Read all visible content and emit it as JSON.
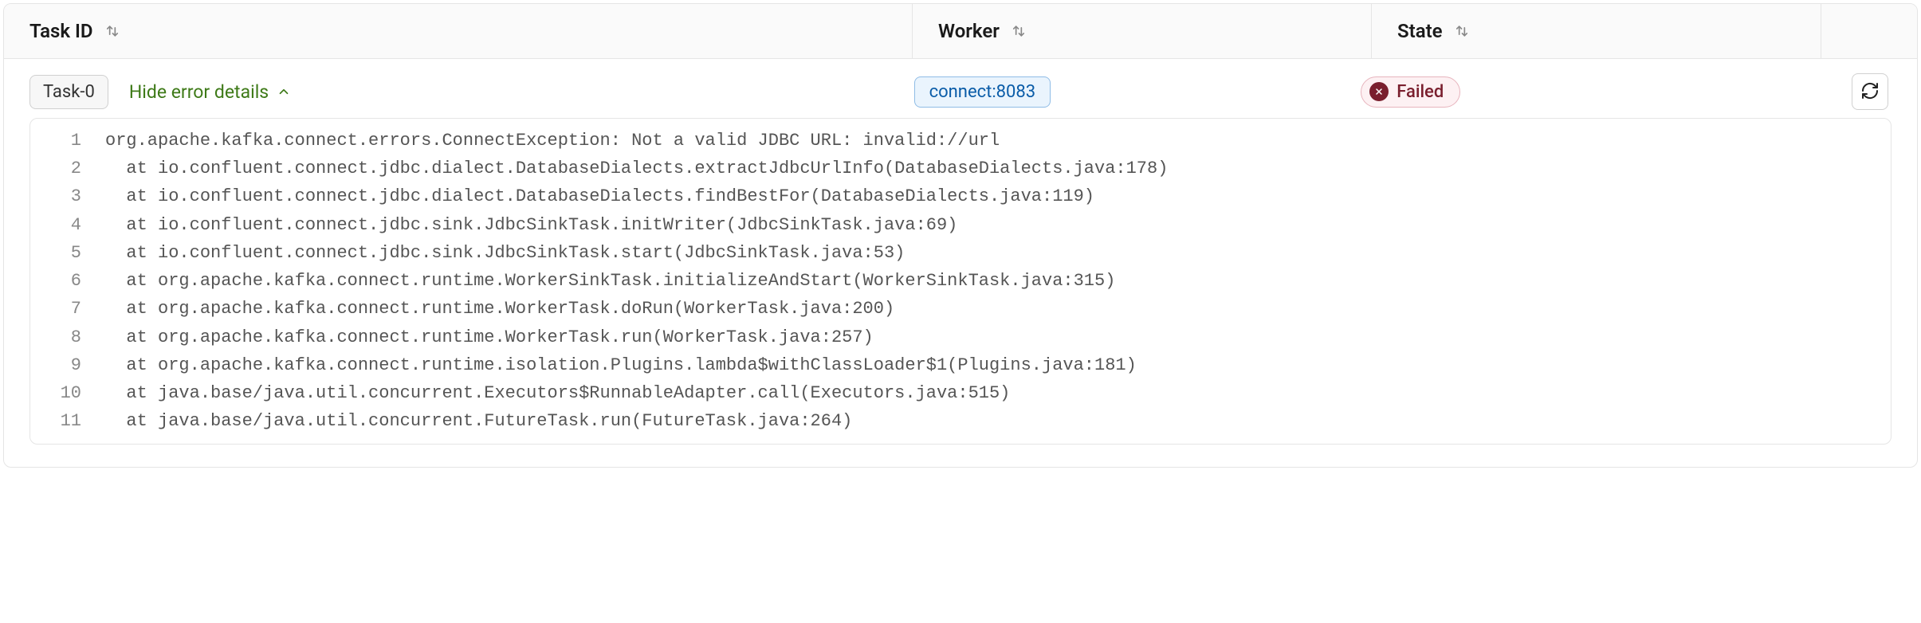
{
  "columns": {
    "task_id": "Task ID",
    "worker": "Worker",
    "state": "State"
  },
  "row": {
    "task_chip": "Task-0",
    "toggle_label": "Hide error details",
    "worker": "connect:8083",
    "state_label": "Failed"
  },
  "error_lines": [
    "org.apache.kafka.connect.errors.ConnectException: Not a valid JDBC URL: invalid://url",
    "  at io.confluent.connect.jdbc.dialect.DatabaseDialects.extractJdbcUrlInfo(DatabaseDialects.java:178)",
    "  at io.confluent.connect.jdbc.dialect.DatabaseDialects.findBestFor(DatabaseDialects.java:119)",
    "  at io.confluent.connect.jdbc.sink.JdbcSinkTask.initWriter(JdbcSinkTask.java:69)",
    "  at io.confluent.connect.jdbc.sink.JdbcSinkTask.start(JdbcSinkTask.java:53)",
    "  at org.apache.kafka.connect.runtime.WorkerSinkTask.initializeAndStart(WorkerSinkTask.java:315)",
    "  at org.apache.kafka.connect.runtime.WorkerTask.doRun(WorkerTask.java:200)",
    "  at org.apache.kafka.connect.runtime.WorkerTask.run(WorkerTask.java:257)",
    "  at org.apache.kafka.connect.runtime.isolation.Plugins.lambda$withClassLoader$1(Plugins.java:181)",
    "  at java.base/java.util.concurrent.Executors$RunnableAdapter.call(Executors.java:515)",
    "  at java.base/java.util.concurrent.FutureTask.run(FutureTask.java:264)"
  ],
  "colors": {
    "status_fg": "#7a1f2e",
    "accent_green": "#3e7a18",
    "worker_blue": "#0a5ca8"
  }
}
